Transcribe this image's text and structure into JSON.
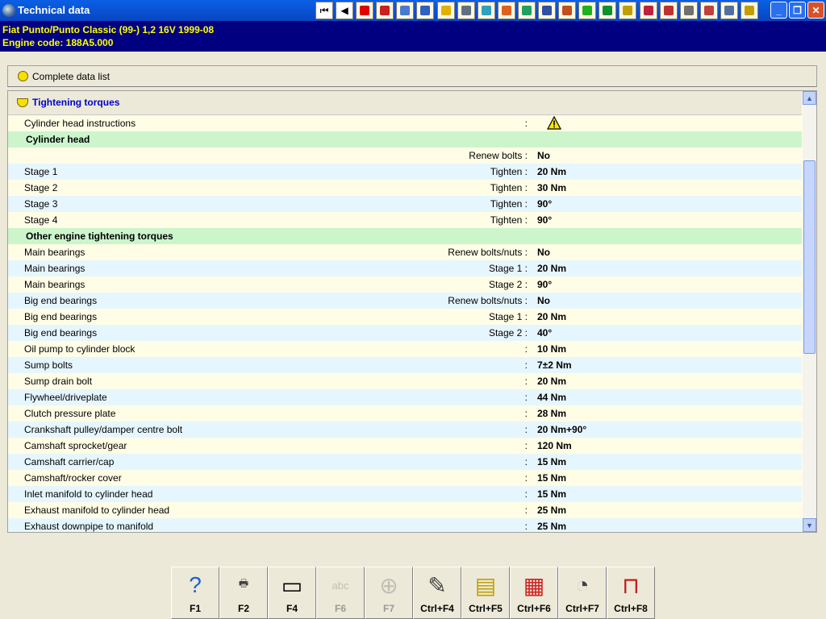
{
  "window": {
    "title": "Technical data"
  },
  "toolbar": {
    "icons": [
      {
        "name": "first-record-icon",
        "color": "#000000",
        "glyph": "⏮"
      },
      {
        "name": "previous-record-icon",
        "color": "#000000",
        "glyph": "◀"
      },
      {
        "name": "warning-icon",
        "color": "#e00000"
      },
      {
        "name": "book-icon",
        "color": "#cc2020"
      },
      {
        "name": "vehicle-id-icon",
        "color": "#4a7ad0"
      },
      {
        "name": "engine-icon",
        "color": "#3060c0"
      },
      {
        "name": "tuning-icon",
        "color": "#e0b000"
      },
      {
        "name": "wheel-icon",
        "color": "#607080"
      },
      {
        "name": "wrench-icon",
        "color": "#30a0c0"
      },
      {
        "name": "timing-belt-icon",
        "color": "#e06020"
      },
      {
        "name": "gearbox-icon",
        "color": "#20a060"
      },
      {
        "name": "mechanic-icon",
        "color": "#3050a0"
      },
      {
        "name": "tools-icon",
        "color": "#c05020"
      },
      {
        "name": "counter-icon",
        "color": "#20b020"
      },
      {
        "name": "lubricant-icon",
        "color": "#109030"
      },
      {
        "name": "help-icon",
        "color": "#c0a000"
      },
      {
        "name": "fuel-icon",
        "color": "#c02040"
      },
      {
        "name": "electrical-icon",
        "color": "#c03030"
      },
      {
        "name": "sensor-icon",
        "color": "#707070"
      },
      {
        "name": "triangle-icon",
        "color": "#c04040"
      },
      {
        "name": "car-icon",
        "color": "#5070a0"
      },
      {
        "name": "document-icon",
        "color": "#c0a000"
      }
    ]
  },
  "vehicle": {
    "line1": "Fiat   Punto/Punto Classic (99-) 1,2 16V 1999-08",
    "line2": "Engine code: 188A5.000"
  },
  "complete_data_list": {
    "label": "Complete data list"
  },
  "section": {
    "label": "Tightening torques"
  },
  "rows": [
    {
      "type": "item",
      "label": "Cylinder head instructions",
      "action": ":",
      "value": "",
      "warn": true
    },
    {
      "type": "group",
      "label": "Cylinder head"
    },
    {
      "type": "item",
      "label": "",
      "action": "Renew bolts :",
      "value": "No"
    },
    {
      "type": "item",
      "label": "Stage 1",
      "action": "Tighten :",
      "value": "20 Nm"
    },
    {
      "type": "item",
      "label": "Stage 2",
      "action": "Tighten :",
      "value": "30 Nm"
    },
    {
      "type": "item",
      "label": "Stage 3",
      "action": "Tighten :",
      "value": "90°"
    },
    {
      "type": "item",
      "label": "Stage 4",
      "action": "Tighten :",
      "value": "90°"
    },
    {
      "type": "group",
      "label": "Other engine tightening torques"
    },
    {
      "type": "item",
      "label": "Main bearings",
      "action": "Renew bolts/nuts :",
      "value": "No"
    },
    {
      "type": "item",
      "label": "Main bearings",
      "action": "Stage 1 :",
      "value": "20 Nm"
    },
    {
      "type": "item",
      "label": "Main bearings",
      "action": "Stage 2 :",
      "value": "90°"
    },
    {
      "type": "item",
      "label": "Big end bearings",
      "action": "Renew bolts/nuts :",
      "value": "No"
    },
    {
      "type": "item",
      "label": "Big end bearings",
      "action": "Stage 1 :",
      "value": "20 Nm"
    },
    {
      "type": "item",
      "label": "Big end bearings",
      "action": "Stage 2 :",
      "value": "40°"
    },
    {
      "type": "item",
      "label": "Oil pump to cylinder block",
      "action": ":",
      "value": "10 Nm"
    },
    {
      "type": "item",
      "label": "Sump bolts",
      "action": ":",
      "value": "7±2 Nm"
    },
    {
      "type": "item",
      "label": "Sump drain bolt",
      "action": ":",
      "value": "20 Nm"
    },
    {
      "type": "item",
      "label": "Flywheel/driveplate",
      "action": ":",
      "value": "44 Nm"
    },
    {
      "type": "item",
      "label": "Clutch pressure plate",
      "action": ":",
      "value": "28 Nm"
    },
    {
      "type": "item",
      "label": "Crankshaft pulley/damper centre bolt",
      "action": ":",
      "value": "20 Nm+90°"
    },
    {
      "type": "item",
      "label": "Camshaft sprocket/gear",
      "action": ":",
      "value": "120 Nm"
    },
    {
      "type": "item",
      "label": "Camshaft carrier/cap",
      "action": ":",
      "value": "15 Nm"
    },
    {
      "type": "item",
      "label": "Camshaft/rocker cover",
      "action": ":",
      "value": "15 Nm"
    },
    {
      "type": "item",
      "label": "Inlet manifold to cylinder head",
      "action": ":",
      "value": "15 Nm"
    },
    {
      "type": "item",
      "label": "Exhaust manifold to cylinder head",
      "action": ":",
      "value": "25 Nm"
    },
    {
      "type": "item",
      "label": "Exhaust downpipe to manifold",
      "action": ":",
      "value": "25 Nm"
    }
  ],
  "fkeys": [
    {
      "key": "F1",
      "name": "help-button",
      "icon": "question-icon",
      "glyph": "?",
      "color": "#2060d0",
      "disabled": false
    },
    {
      "key": "F2",
      "name": "print-button",
      "icon": "printer-icon",
      "glyph": "🖶",
      "color": "#404040",
      "disabled": false
    },
    {
      "key": "F4",
      "name": "screen-button",
      "icon": "monitor-icon",
      "glyph": "▭",
      "color": "#000000",
      "disabled": false
    },
    {
      "key": "F6",
      "name": "f6-button",
      "icon": "text-search-icon",
      "glyph": "abc",
      "color": "#808080",
      "disabled": true
    },
    {
      "key": "F7",
      "name": "f7-button",
      "icon": "crosshair-icon",
      "glyph": "⊕",
      "color": "#808080",
      "disabled": true
    },
    {
      "key": "Ctrl+F4",
      "name": "ctrl-f4-button",
      "icon": "notes-icon",
      "glyph": "✎",
      "color": "#404040",
      "disabled": false
    },
    {
      "key": "Ctrl+F5",
      "name": "ctrl-f5-button",
      "icon": "list-icon",
      "glyph": "▤",
      "color": "#c0a000",
      "disabled": false
    },
    {
      "key": "Ctrl+F6",
      "name": "ctrl-f6-button",
      "icon": "calculator-icon",
      "glyph": "▦",
      "color": "#d02020",
      "disabled": false
    },
    {
      "key": "Ctrl+F7",
      "name": "ctrl-f7-button",
      "icon": "gauge-icon",
      "glyph": "◔",
      "color": "#404040",
      "disabled": false
    },
    {
      "key": "Ctrl+F8",
      "name": "ctrl-f8-button",
      "icon": "lift-icon",
      "glyph": "⊓",
      "color": "#c02020",
      "disabled": false
    }
  ]
}
